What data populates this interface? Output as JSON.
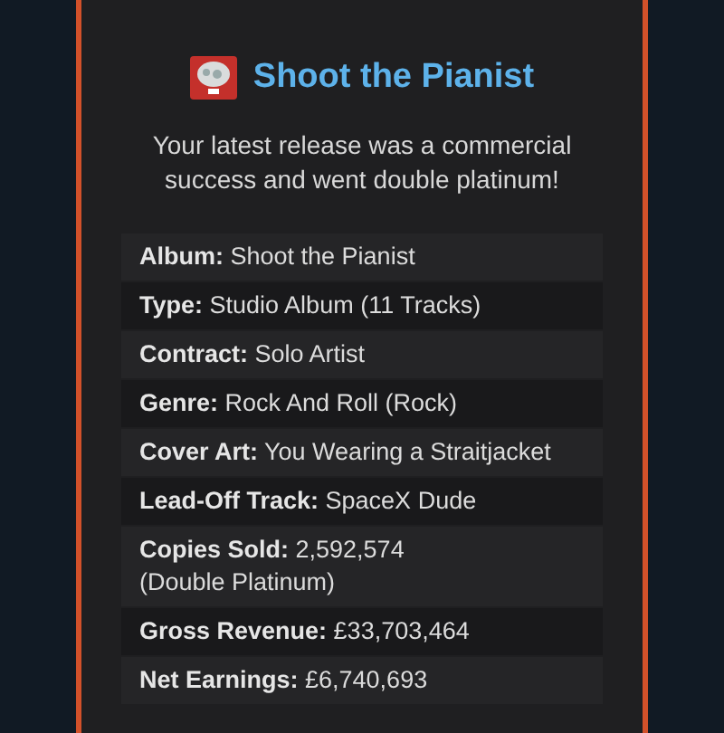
{
  "dialog": {
    "title": "Shoot the Pianist",
    "message": "Your latest release was a commercial success and went double platinum!",
    "details": [
      {
        "text": "**Album:** Shoot the Pianist"
      },
      {
        "text": "**Type:** Studio Album (11 Tracks)"
      },
      {
        "text": "**Contract:** Solo Artist"
      },
      {
        "text": "**Genre:** Rock And Roll (Rock)"
      },
      {
        "text": "**Cover Art:** You Wearing a Straitjacket"
      },
      {
        "text": "**Lead-Off Track:** SpaceX Dude"
      },
      {
        "text": "**Copies Sold:** 2,592,574",
        "note": "(Double Platinum)"
      },
      {
        "text": "**Gross Revenue:** £33,703,464"
      },
      {
        "text": "**Net Earnings:** £6,740,693"
      }
    ]
  }
}
